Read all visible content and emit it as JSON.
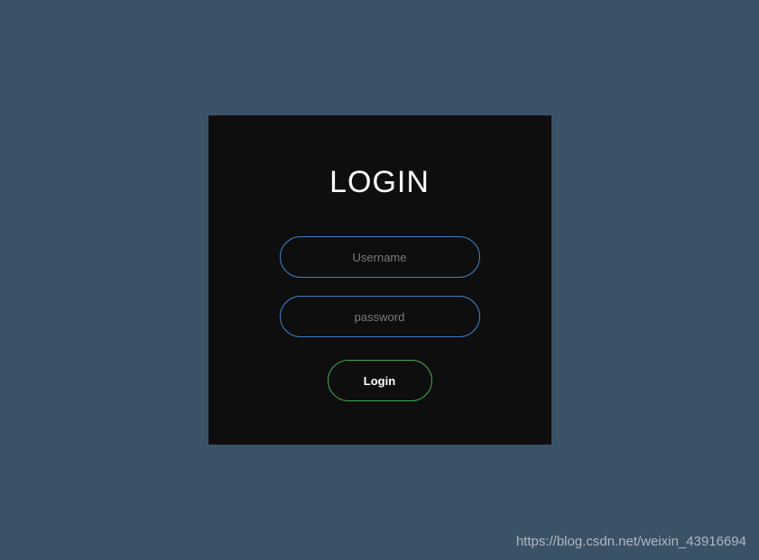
{
  "login": {
    "title": "LOGIN",
    "username_placeholder": "Username",
    "username_value": "",
    "password_placeholder": "password",
    "password_value": "",
    "button_label": "Login"
  },
  "watermark": "https://blog.csdn.net/weixin_43916694",
  "colors": {
    "background": "#3b5166",
    "panel": "#0e0e0e",
    "input_border": "#3d7fc7",
    "button_border": "#3fa84e"
  }
}
